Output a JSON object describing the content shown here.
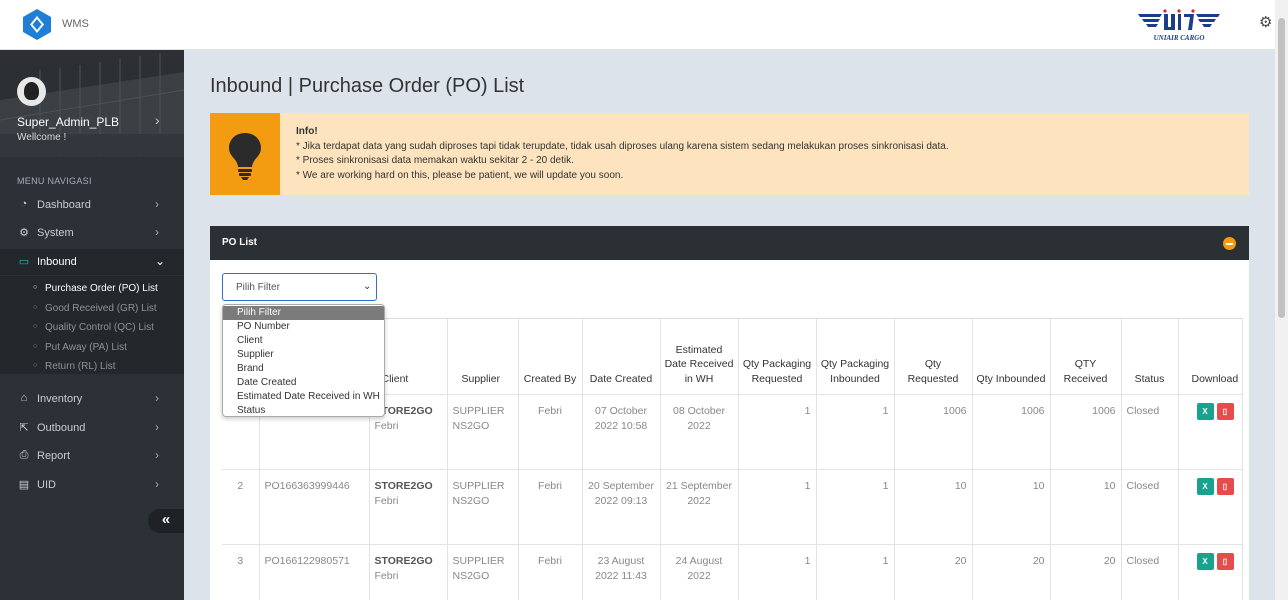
{
  "app": {
    "name": "WMS",
    "brand": "UNIAIR CARGO"
  },
  "user": {
    "name": "Super_Admin_PLB",
    "greeting": "Wellcome !"
  },
  "menu": {
    "header": "MENU NAVIGASI",
    "items": [
      {
        "label": "Dashboard",
        "icon": "dashboard-icon"
      },
      {
        "label": "System",
        "icon": "gear-icon"
      },
      {
        "label": "Inbound",
        "icon": "inbox-icon"
      },
      {
        "label": "Inventory",
        "icon": "bank-icon"
      },
      {
        "label": "Outbound",
        "icon": "external-link-icon"
      },
      {
        "label": "Report",
        "icon": "printer-icon"
      },
      {
        "label": "UID",
        "icon": "id-card-icon"
      }
    ],
    "inbound_sub": [
      {
        "label": "Purchase Order (PO) List"
      },
      {
        "label": "Good Received (GR) List"
      },
      {
        "label": "Quality Control (QC) List"
      },
      {
        "label": "Put Away (PA) List"
      },
      {
        "label": "Return (RL) List"
      }
    ],
    "collapse": "«"
  },
  "page": {
    "title": "Inbound | Purchase Order (PO) List"
  },
  "info": {
    "title": "Info!",
    "lines": [
      "* Jika terdapat data yang sudah diproses tapi tidak terupdate, tidak usah diproses ulang karena sistem sedang melakukan proses sinkronisasi data.",
      "* Proses sinkronisasi data memakan waktu sekitar 2 - 20 detik.",
      "* We are working hard on this, please be patient, we will update you soon."
    ],
    "accent": "#f39c12"
  },
  "card": {
    "title": "PO List"
  },
  "filter": {
    "selected": "Pilih Filter",
    "options": [
      "Pilih Filter",
      "PO Number",
      "Client",
      "Supplier",
      "Brand",
      "Date Created",
      "Estimated Date Received in WH",
      "Status"
    ]
  },
  "table": {
    "headers": {
      "client": "Client",
      "supplier": "Supplier",
      "created_by": "Created By",
      "date_created": "Date Created",
      "est_date": "Estimated Date Received in WH",
      "qty_pack_req": "Qty Packaging Requested",
      "qty_pack_inb": "Qty Packaging Inbounded",
      "qty_req": "Qty Requested",
      "qty_inb": "Qty Inbounded",
      "qty_rec": "QTY Received",
      "status": "Status",
      "download": "Download"
    },
    "rows": [
      {
        "no": "",
        "po": "",
        "client": "STORE2GO",
        "client_sub": "Febri",
        "supplier": "SUPPLIER NS2GO",
        "created_by": "Febri",
        "date_created": "07 October 2022 10:58",
        "est_date": "08 October 2022",
        "qty_pack_req": "1",
        "qty_pack_inb": "1",
        "qty_req": "1006",
        "qty_inb": "1006",
        "qty_rec": "1006",
        "status": "Closed"
      },
      {
        "no": "2",
        "po": "PO166363999446",
        "client": "STORE2GO",
        "client_sub": "Febri",
        "supplier": "SUPPLIER NS2GO",
        "created_by": "Febri",
        "date_created": "20 September 2022 09:13",
        "est_date": "21 September 2022",
        "qty_pack_req": "1",
        "qty_pack_inb": "1",
        "qty_req": "10",
        "qty_inb": "10",
        "qty_rec": "10",
        "status": "Closed"
      },
      {
        "no": "3",
        "po": "PO166122980571",
        "client": "STORE2GO",
        "client_sub": "Febri",
        "supplier": "SUPPLIER NS2GO",
        "created_by": "Febri",
        "date_created": "23 August 2022 11:43",
        "est_date": "24 August 2022",
        "qty_pack_req": "1",
        "qty_pack_inb": "1",
        "qty_req": "20",
        "qty_inb": "20",
        "qty_rec": "20",
        "status": "Closed"
      }
    ]
  }
}
